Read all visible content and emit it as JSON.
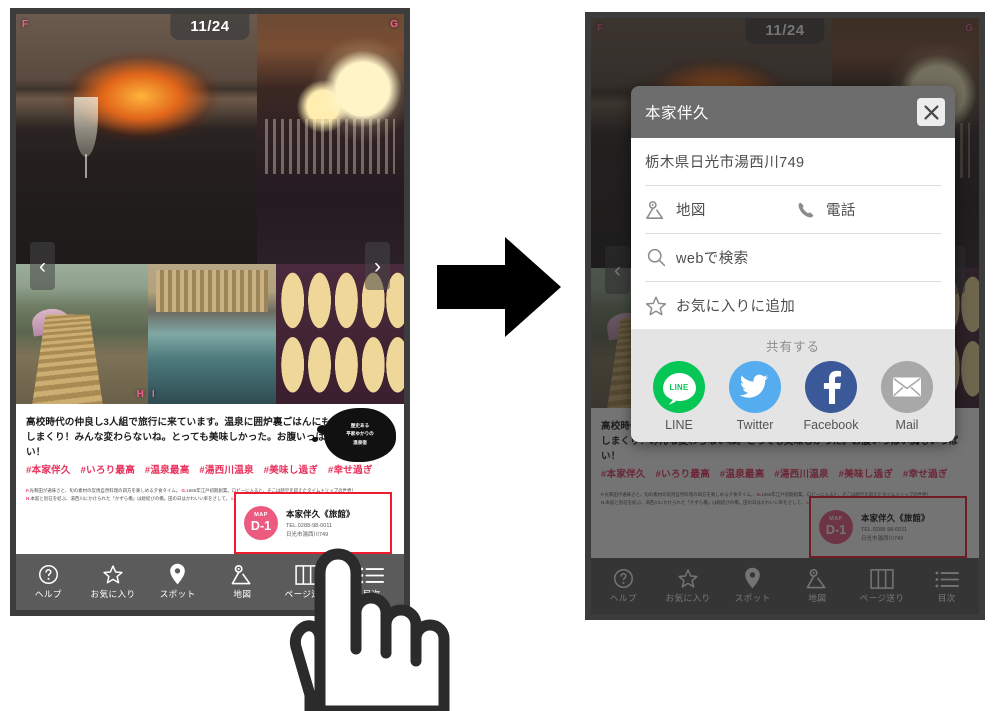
{
  "meta": {
    "page_counter": "11/24",
    "panel_labels": {
      "f": "F",
      "g": "G",
      "h": "H",
      "i": "I"
    },
    "carousel_prev": "‹",
    "carousel_next": "›"
  },
  "article": {
    "line1": "高校時代の仲良し3人組で旅行に来ています。温泉に囲炉裏ごはんにもう満喫",
    "line2": "しまくり！みんな変わらないね。とっても美味しかった。お腹いっぱい胸もいっぱい！",
    "tags": "#本家伴久　#いろり最高　#温泉最高　#湯西川温泉　#美味し過ぎ　#幸せ過ぎ",
    "caption_line1_mk1": "F.",
    "caption_line1_a": "光和田が通味さと、旬の素材の炭焼自然料理の四方を楽しめる夕食タイム。",
    "caption_line1_mk2": "G.",
    "caption_line1_b": "1666年江戸初期創業。ロビーに入ると、そこは時空を超えたタイムトリップの世界！",
    "caption_line2_mk1": "H.",
    "caption_line2_a": "本館と別荘を結ぶ、湯西川にかけられた「かずら橋」は総結びの橋。田の日はかわいい率をさして。",
    "caption_line2_mk2": "I.",
    "caption_line2_b": "4～5人は入れる連帯後の流しの貸切露天風呂は計3種類。"
  },
  "bubble": {
    "line1": "歴史ある",
    "line2": "平家ゆかりの",
    "line3": "温泉宿"
  },
  "spot_card": {
    "badge_top": "MAP",
    "badge_id": "D-1",
    "name": "本家伴久《旅館》",
    "tel": "TEL.0288-98-0011",
    "address": "日光市湯西川749",
    "highlight_color": "#ee1c2e",
    "badge_color": "#ed5a80"
  },
  "navbar": {
    "items": [
      {
        "icon": "help-circle-icon",
        "label": "ヘルプ"
      },
      {
        "icon": "star-icon",
        "label": "お気に入り"
      },
      {
        "icon": "map-pin-icon",
        "label": "スポット"
      },
      {
        "icon": "map-icon",
        "label": "地図"
      },
      {
        "icon": "columns-icon",
        "label": "ページ送り"
      },
      {
        "icon": "list-icon",
        "label": "目次"
      }
    ]
  },
  "modal": {
    "title": "本家伴久",
    "close_icon": "close-icon",
    "address": "栃木県日光市湯西川749",
    "actions": [
      {
        "icon": "map-icon",
        "label": "地図"
      },
      {
        "icon": "phone-icon",
        "label": "電話"
      },
      {
        "icon": "search-icon",
        "label": "webで検索"
      },
      {
        "icon": "star-icon",
        "label": "お気に入りに追加"
      }
    ],
    "share": {
      "title": "共有する",
      "items": [
        {
          "id": "line-share-icon",
          "label": "LINE",
          "color": "#06c755",
          "badge": "LINE"
        },
        {
          "id": "twitter-share-icon",
          "label": "Twitter",
          "color": "#55acee"
        },
        {
          "id": "facebook-share-icon",
          "label": "Facebook",
          "color": "#3b5998"
        },
        {
          "id": "mail-share-icon",
          "label": "Mail",
          "color": "#a8a8a8"
        }
      ]
    }
  },
  "flow": {
    "arrow_icon": "right-arrow-icon",
    "cursor_icon": "hand-pointer-cursor"
  }
}
